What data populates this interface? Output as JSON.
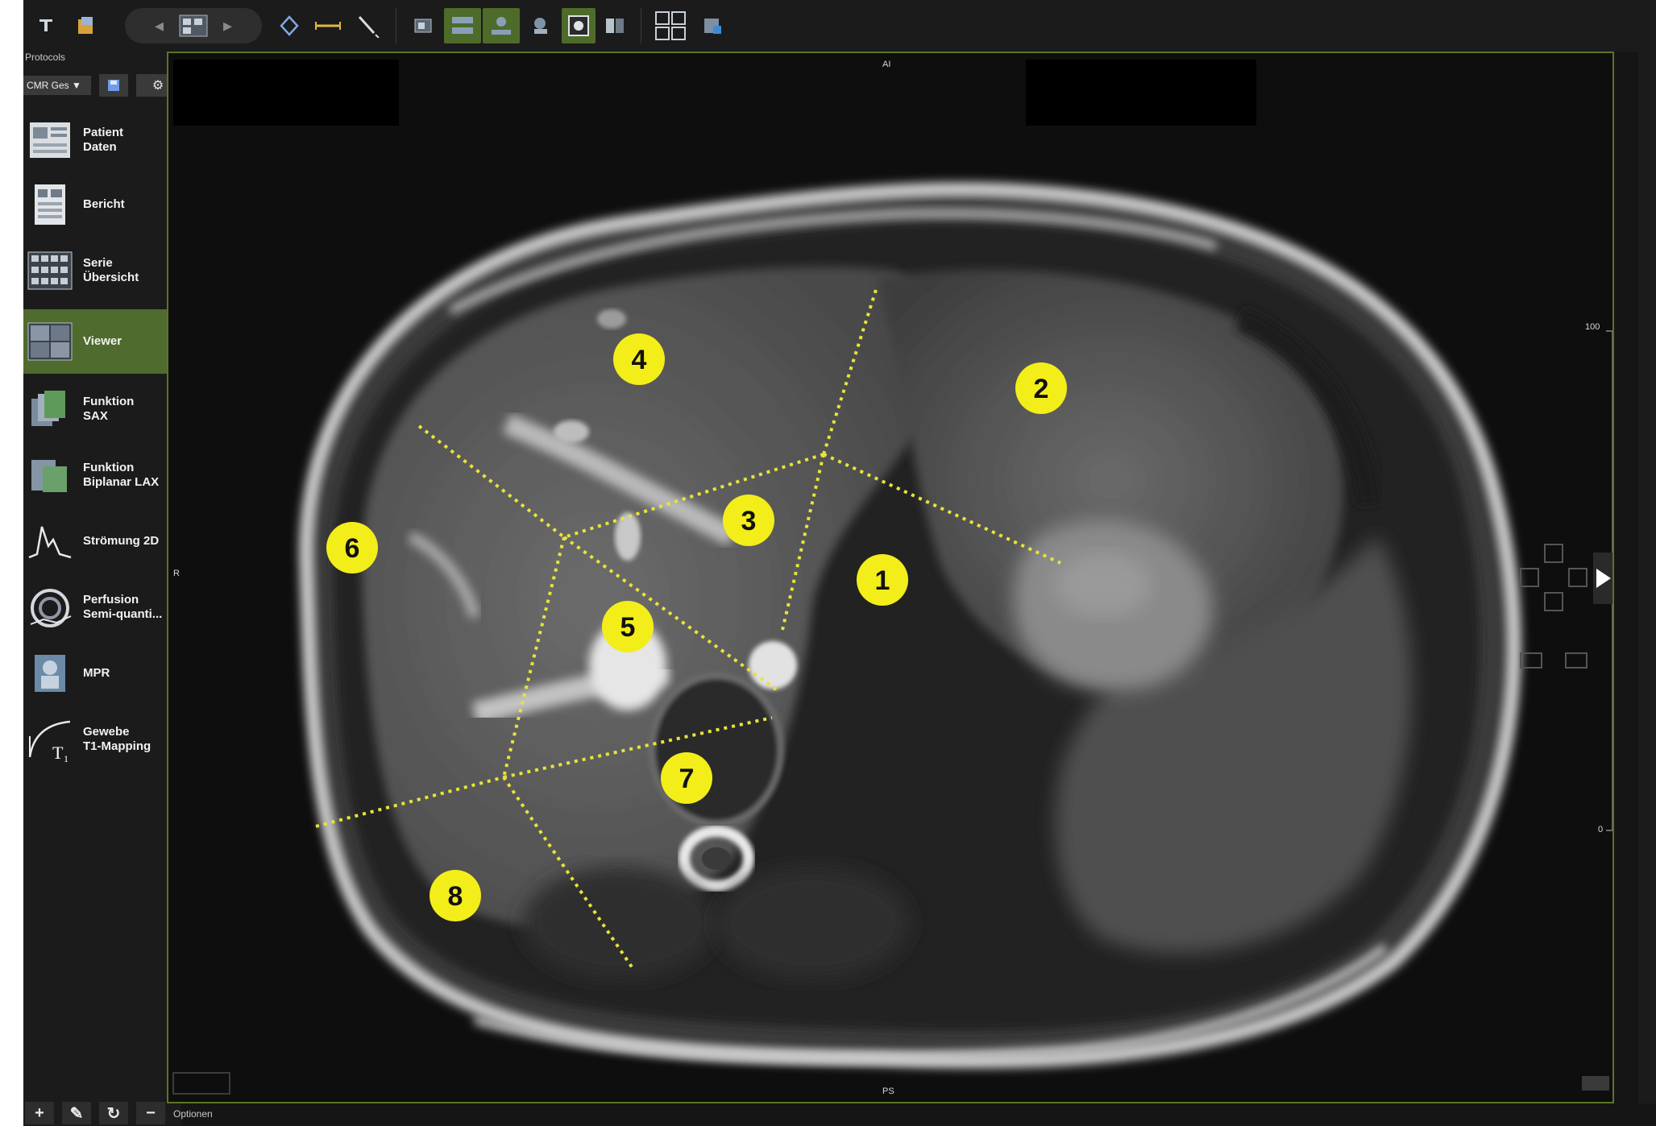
{
  "toolbar": {
    "icons": [
      "layout-icon",
      "export-icon",
      "previous-series-icon",
      "series-select-icon",
      "next-series-icon",
      "roi-tool-icon",
      "ruler-icon",
      "pointer-icon",
      "window-level-icon",
      "series-sync-icon",
      "cross-reference-icon",
      "magnify-icon",
      "invert-icon",
      "compare-icon",
      "grid-layout-icon",
      "save-image-icon"
    ]
  },
  "sidebar": {
    "protocols_label": "Protocols",
    "protocol_select": "CMR Ges ▼",
    "items": [
      {
        "label": "Patient\nDaten",
        "icon": "patient-data-icon"
      },
      {
        "label": "Bericht",
        "icon": "report-icon"
      },
      {
        "label": "Serie\nÜbersicht",
        "icon": "series-overview-icon"
      },
      {
        "label": "Viewer",
        "icon": "viewer-icon",
        "active": true
      },
      {
        "label": "Funktion\nSAX",
        "icon": "function-sax-icon"
      },
      {
        "label": "Funktion\nBiplanar LAX",
        "icon": "function-lax-icon"
      },
      {
        "label": "Strömung 2D",
        "icon": "flow-2d-icon"
      },
      {
        "label": "Perfusion\nSemi-quanti...",
        "icon": "perfusion-icon"
      },
      {
        "label": "MPR",
        "icon": "mpr-icon"
      },
      {
        "label": "Gewebe\nT1-Mapping",
        "icon": "t1-mapping-icon"
      }
    ],
    "bottom_buttons": [
      "+",
      "✎",
      "↻",
      "−"
    ]
  },
  "viewer": {
    "orientation": {
      "top": "AI",
      "left": "R",
      "bottom": "PS"
    },
    "scale": {
      "max": "100",
      "min": "0"
    },
    "segments": [
      {
        "label": "1"
      },
      {
        "label": "2"
      },
      {
        "label": "3"
      },
      {
        "label": "4"
      },
      {
        "label": "5"
      },
      {
        "label": "6"
      },
      {
        "label": "7"
      },
      {
        "label": "8"
      }
    ],
    "options_label": "Optionen"
  },
  "colors": {
    "accent": "#5b7428",
    "active_nav": "#4f6b2e",
    "segment_marker": "#f3ee1a",
    "segment_line": "#e9e33a"
  }
}
